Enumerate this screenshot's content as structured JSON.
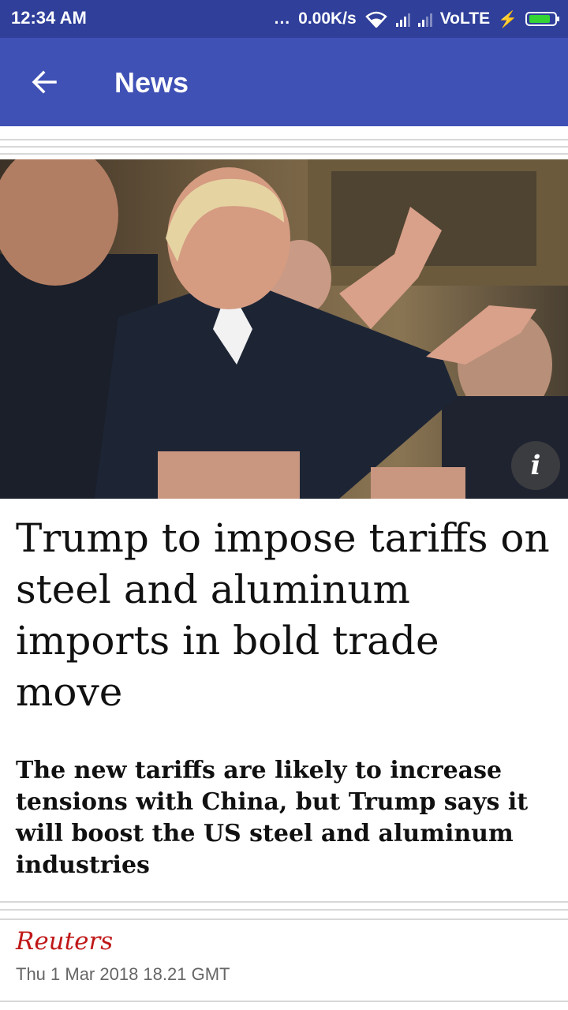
{
  "status_bar": {
    "time": "12:34 AM",
    "dots": "...",
    "speed": "0.00K/s",
    "network": "VoLTE",
    "icons": [
      "wifi-icon",
      "signal-icon",
      "signal-icon",
      "charging-icon",
      "battery-icon"
    ]
  },
  "app_bar": {
    "back_icon": "arrow-left-icon",
    "title": "News",
    "color": "#3f51b5"
  },
  "article": {
    "image_icon": "info-icon",
    "info_label": "i",
    "headline": "Trump to impose tariffs on steel and aluminum imports in bold trade move",
    "subheadline": "The new tariffs are likely to increase tensions with China, but Trump says it will boost the US steel and aluminum industries",
    "source": "Reuters",
    "source_color": "#c01717",
    "date": "Thu 1 Mar 2018 18.21 GMT"
  }
}
